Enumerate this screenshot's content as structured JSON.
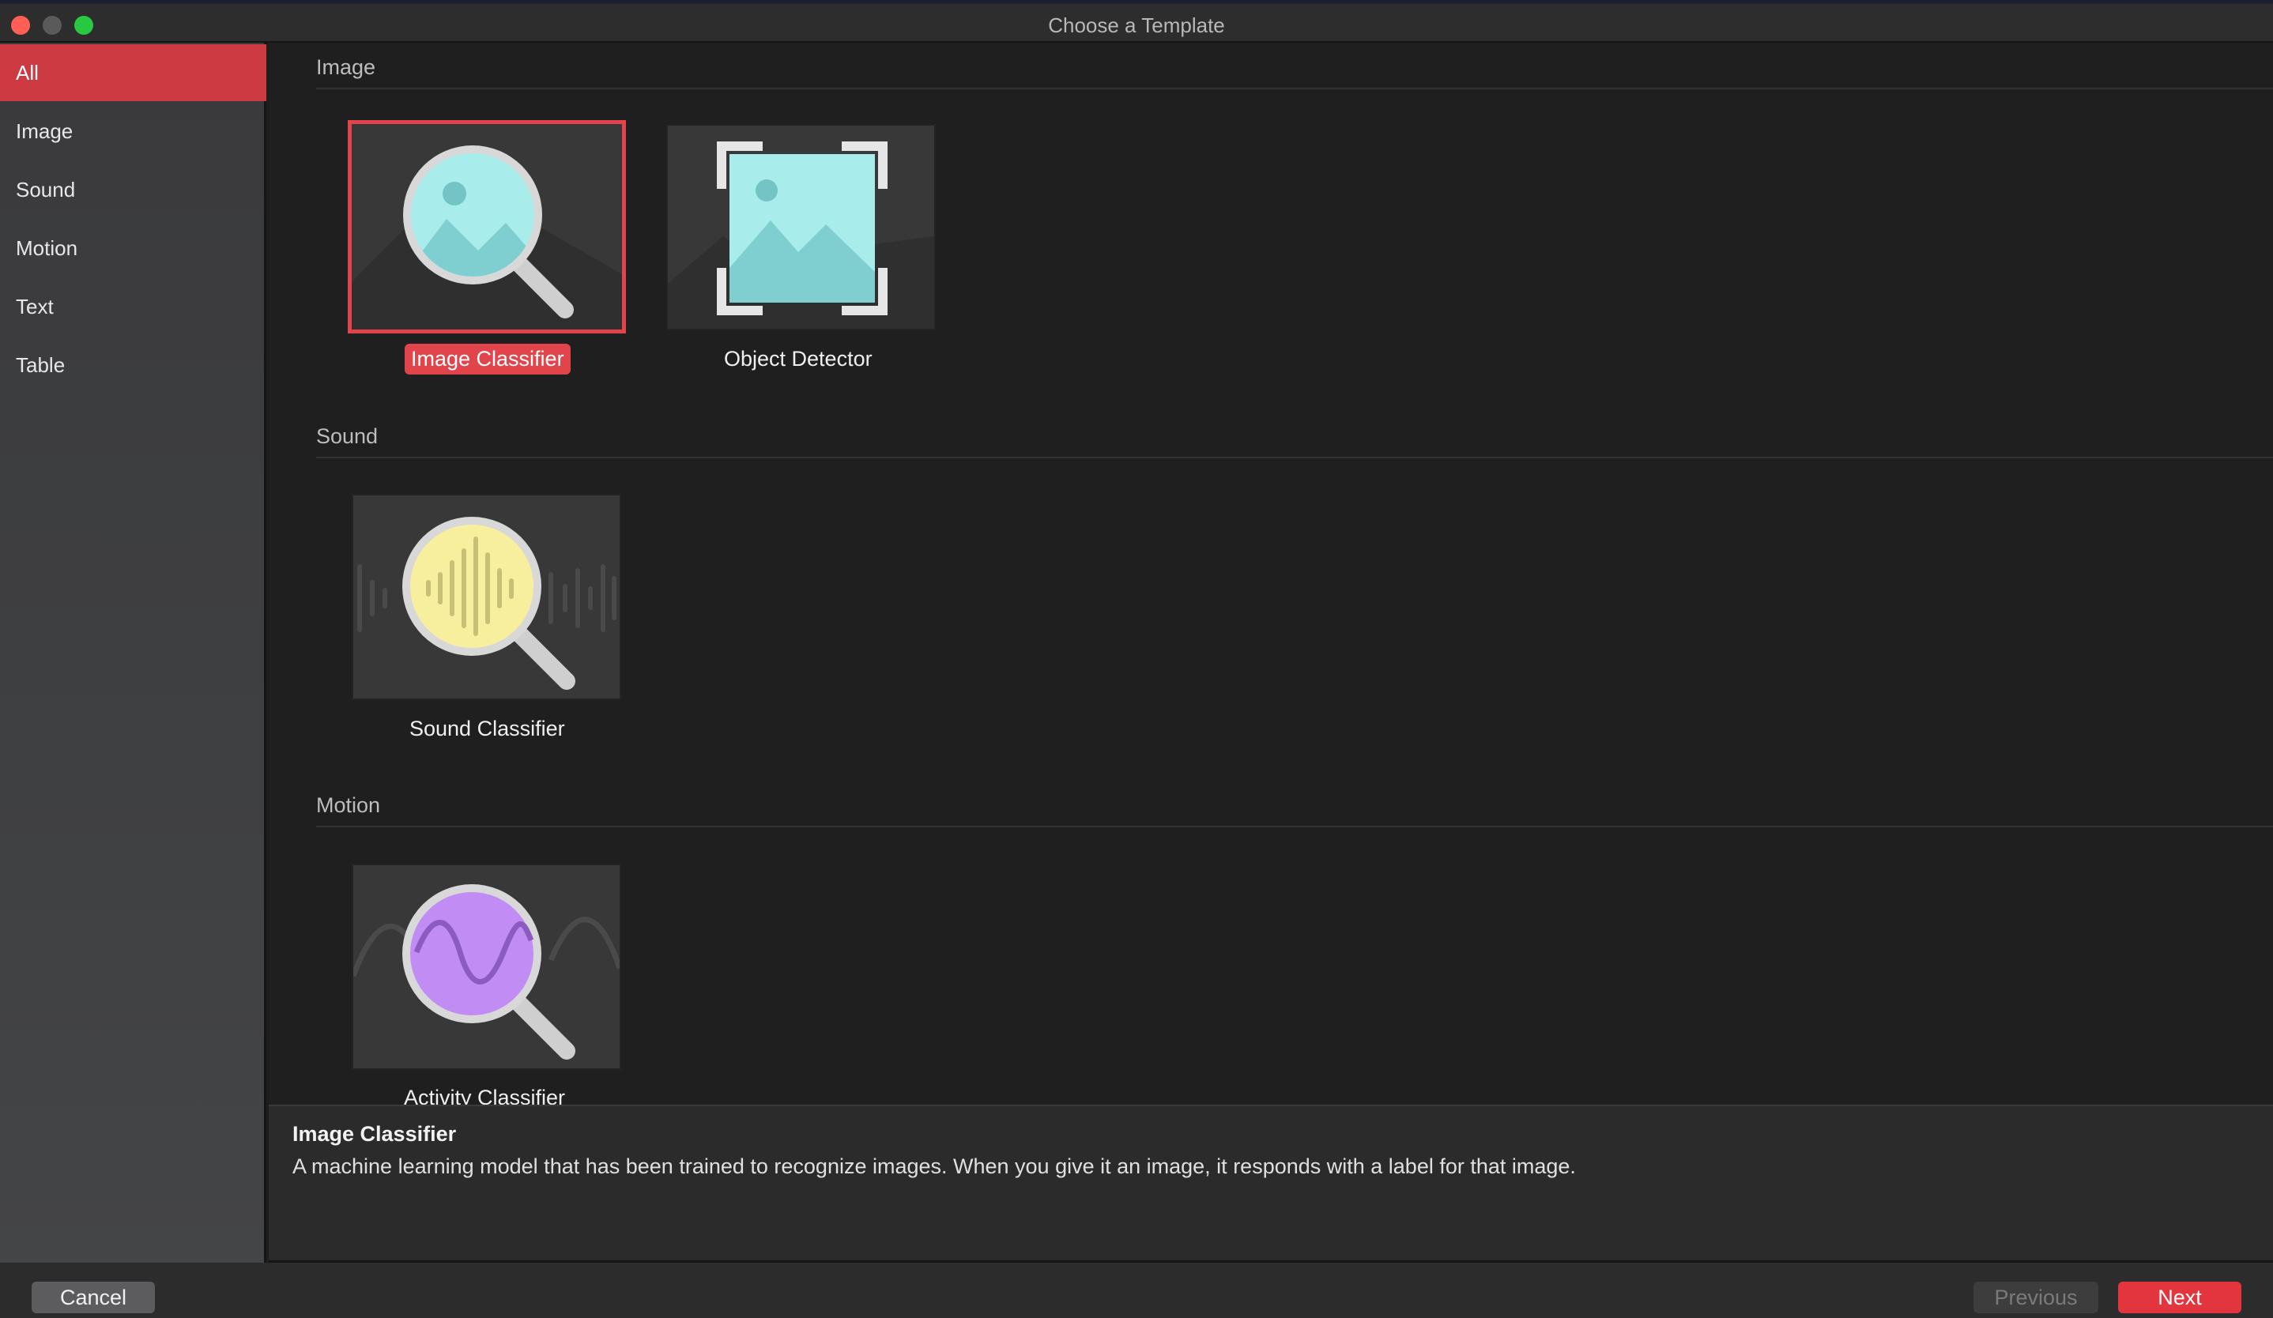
{
  "window": {
    "title": "Choose a Template"
  },
  "sidebar": {
    "items": [
      {
        "label": "All",
        "active": true
      },
      {
        "label": "Image"
      },
      {
        "label": "Sound"
      },
      {
        "label": "Motion"
      },
      {
        "label": "Text"
      },
      {
        "label": "Table"
      }
    ]
  },
  "sections": [
    {
      "title": "Image",
      "templates": [
        {
          "label": "Image Classifier",
          "icon": "image-classifier-icon",
          "selected": true
        },
        {
          "label": "Object Detector",
          "icon": "object-detector-icon"
        }
      ]
    },
    {
      "title": "Sound",
      "templates": [
        {
          "label": "Sound Classifier",
          "icon": "sound-classifier-icon"
        }
      ]
    },
    {
      "title": "Motion",
      "templates": [
        {
          "label": "Activity Classifier",
          "icon": "activity-classifier-icon"
        }
      ]
    }
  ],
  "details": {
    "title": "Image Classifier",
    "description": "A machine learning model that has been trained to recognize images. When you give it an image, it responds with a label for that image."
  },
  "footer": {
    "cancel_label": "Cancel",
    "previous_label": "Previous",
    "next_label": "Next"
  },
  "colors": {
    "accent": "#e2444c",
    "sidebar_active": "#cd3a42",
    "image_icon": "#9fe5e5",
    "sound_icon": "#f5eb9a",
    "motion_icon": "#c08af2"
  }
}
